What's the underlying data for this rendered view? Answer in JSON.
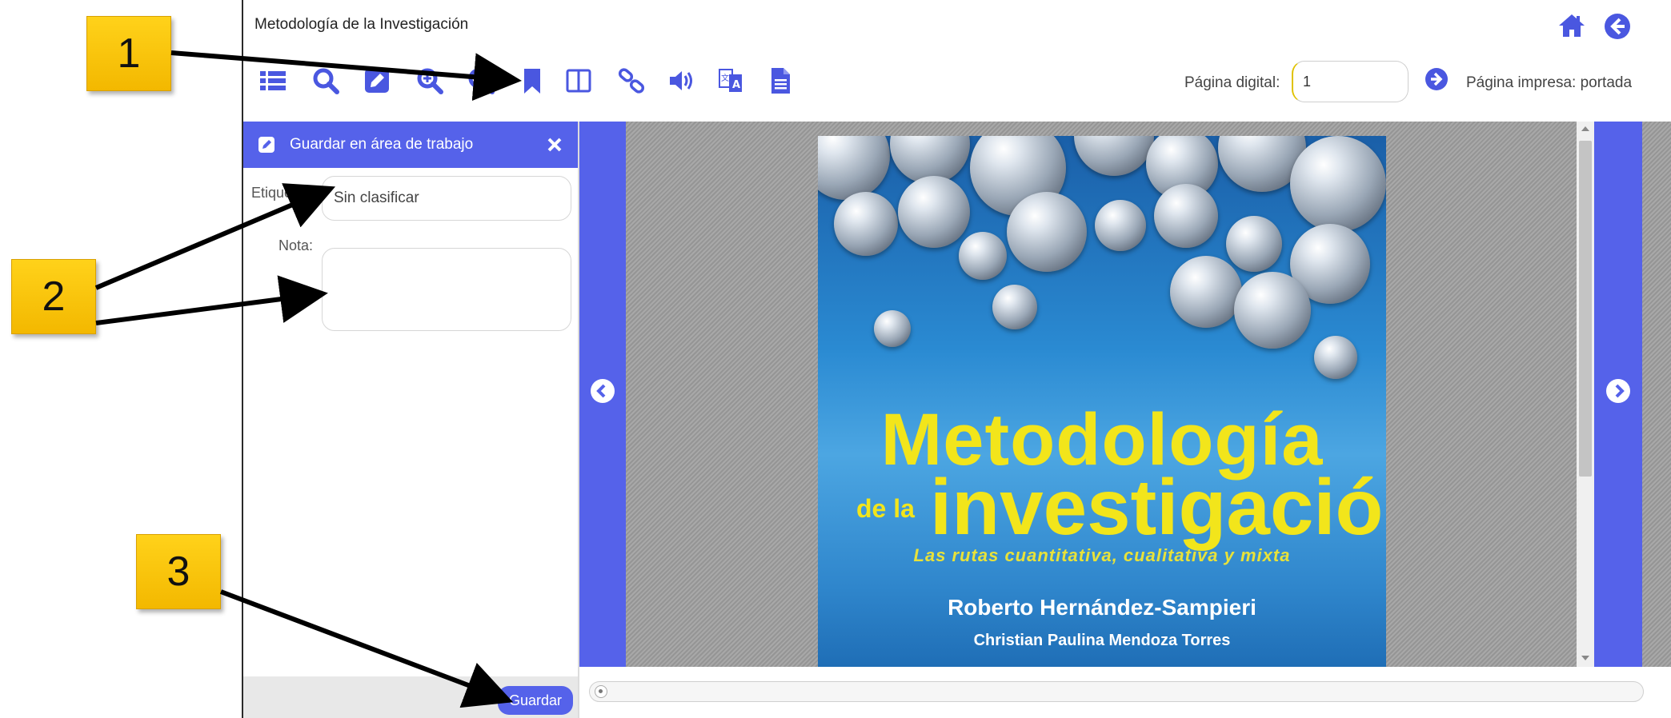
{
  "app": {
    "title": "Metodología de la Investigación"
  },
  "toolbar": {
    "icons": [
      "list-icon",
      "search-icon",
      "edit-icon",
      "zoom-in-icon",
      "zoom-out-icon",
      "bookmark-icon",
      "columns-icon",
      "link-icon",
      "audio-icon",
      "translate-icon",
      "document-icon"
    ],
    "digital_page_label": "Página digital:",
    "digital_page_value": "1",
    "printed_page_label": "Página impresa: portada"
  },
  "panel": {
    "header_title": "Guardar en área de trabajo",
    "etiqueta_label": "Etiqueta:",
    "etiqueta_value": "Sin clasificar",
    "nota_label": "Nota:",
    "nota_value": "",
    "save_label": "Guardar"
  },
  "cover": {
    "title_line1": "Metodología",
    "title_prefix": "de la",
    "title_line2": "investigación",
    "subtitle": "Las rutas cuantitativa, cualitativa y mixta",
    "author1": "Roberto Hernández-Sampieri",
    "author2": "Christian Paulina Mendoza Torres"
  },
  "callouts": [
    "1",
    "2",
    "3"
  ],
  "colors": {
    "accent": "#5562ea",
    "callout": "#f8c300",
    "cover_title": "#f2e51b"
  }
}
